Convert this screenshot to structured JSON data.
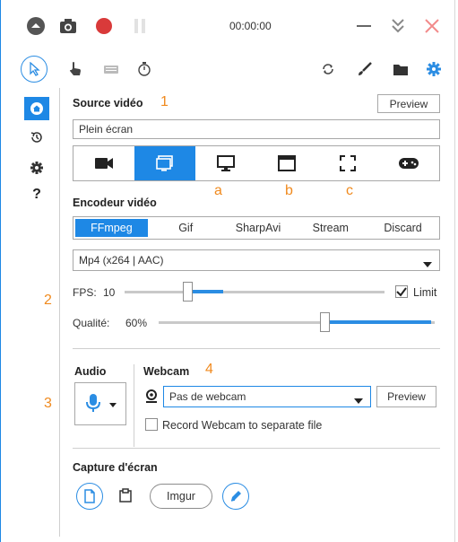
{
  "titlebar": {
    "time": "00:00:00",
    "icons": [
      "chevron-up-circle-icon",
      "camera-icon",
      "record-icon",
      "pause-icon",
      "minimize-icon",
      "collapse-icon",
      "close-icon"
    ]
  },
  "toolbar": {
    "icons": [
      "cursor-icon",
      "hand-icon",
      "keyboard-icon",
      "timer-icon",
      "refresh-icon",
      "brush-icon",
      "folder-icon",
      "gear-icon"
    ]
  },
  "sidebar": {
    "items": [
      {
        "icon": "home-icon",
        "label": ""
      },
      {
        "icon": "history-icon",
        "label": ""
      },
      {
        "icon": "settings-icon",
        "label": ""
      },
      {
        "icon": "help-icon",
        "label": "?"
      }
    ]
  },
  "source": {
    "title": "Source vidéo",
    "annotation": "1",
    "preview_label": "Preview",
    "value": "Plein écran",
    "buttons": [
      "video-camera-icon",
      "screen-region-icon",
      "monitor-icon",
      "window-icon",
      "fullscreen-icon",
      "gamepad-icon"
    ],
    "letters": [
      "a",
      "b",
      "c"
    ]
  },
  "encoder": {
    "title": "Encodeur vidéo",
    "tabs": [
      "FFmpeg",
      "Gif",
      "SharpAvi",
      "Stream",
      "Discard"
    ],
    "format_value": "Mp4 (x264 | AAC)",
    "annotation": "2",
    "fps_label": "FPS:",
    "fps_value": "10",
    "fps_level": 0.24,
    "limit_label": "Limit",
    "limit_checked": true,
    "quality_label": "Qualité:",
    "quality_value": "60%",
    "quality_level": 0.6
  },
  "audio": {
    "title": "Audio",
    "annotation": "3"
  },
  "webcam": {
    "title": "Webcam",
    "annotation": "4",
    "value": "Pas de webcam",
    "preview_label": "Preview",
    "separate_label": "Record Webcam to separate file"
  },
  "capture": {
    "title": "Capture d'écran",
    "imgur_label": "Imgur"
  },
  "colors": {
    "accent": "#1e88e5",
    "record": "#d93a3a",
    "annotation": "#f08a1e",
    "close": "#f28b8b"
  }
}
